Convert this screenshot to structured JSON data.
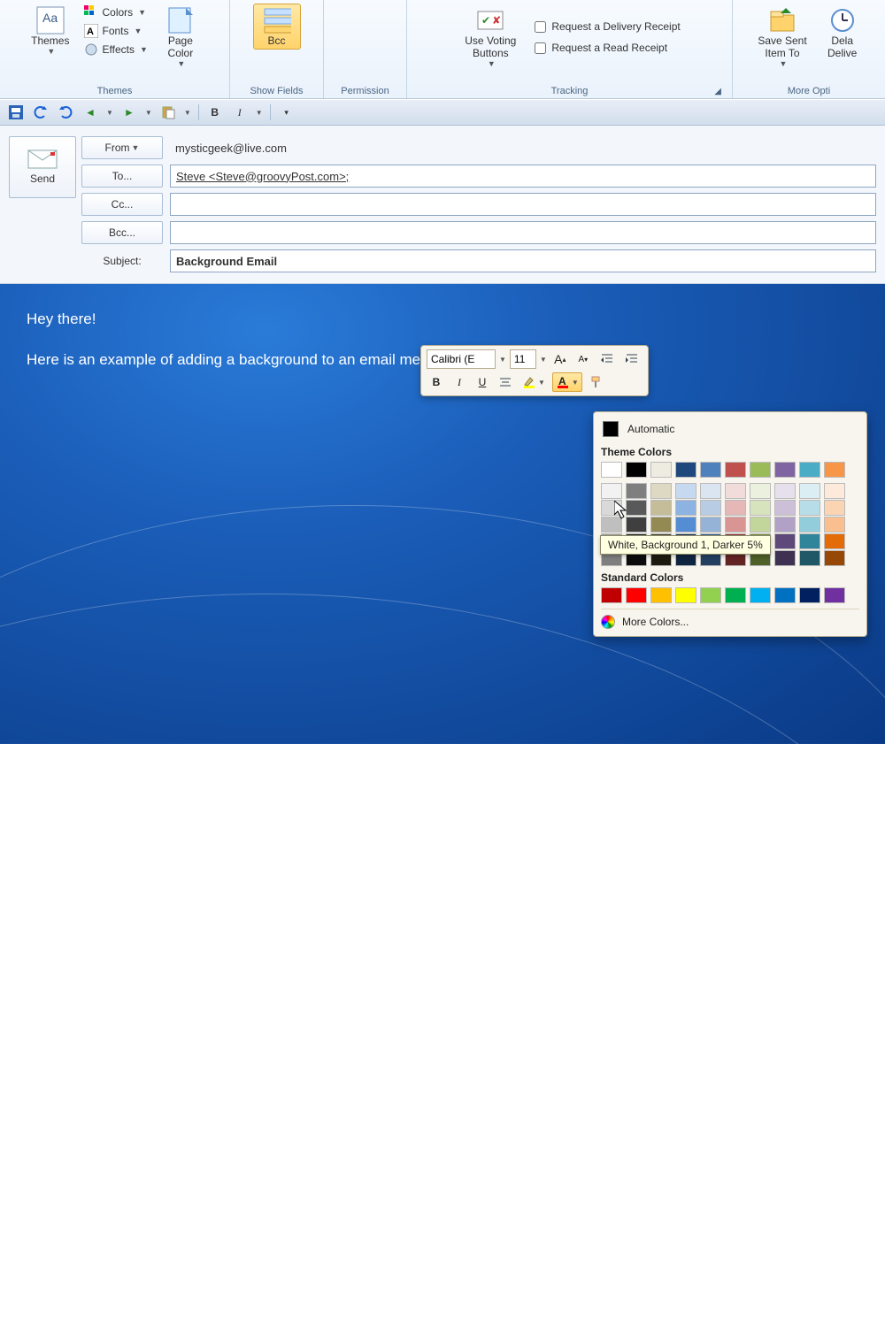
{
  "ribbon": {
    "themes": {
      "label": "Themes",
      "btn": "Themes",
      "colors": "Colors",
      "fonts": "Fonts",
      "effects": "Effects",
      "pagecolor": "Page\nColor"
    },
    "showfields": {
      "label": "Show Fields",
      "bcc": "Bcc"
    },
    "permission": {
      "label": "Permission"
    },
    "tracking": {
      "label": "Tracking",
      "voting": "Use Voting\nButtons",
      "delivery": "Request a Delivery Receipt",
      "read": "Request a Read Receipt"
    },
    "moreoptions": {
      "label": "More Opti",
      "savesent": "Save Sent\nItem To",
      "delay": "Dela\nDelive"
    }
  },
  "qat": {},
  "compose": {
    "send": "Send",
    "from_btn": "From",
    "from_val": "mysticgeek@live.com",
    "to_btn": "To...",
    "to_val": "Steve <Steve@groovyPost.com>;",
    "cc_btn": "Cc...",
    "cc_val": "",
    "bcc_btn": "Bcc...",
    "bcc_val": "",
    "subject_lbl": "Subject:",
    "subject_val": "Background Email"
  },
  "body": {
    "line1": "Hey there!",
    "line2": "Here is an example of adding a background to an email message."
  },
  "mini": {
    "font": "Calibri (E",
    "size": "11"
  },
  "picker": {
    "automatic": "Automatic",
    "theme_header": "Theme Colors",
    "standard_header": "Standard Colors",
    "more": "More Colors...",
    "tooltip": "White, Background 1, Darker 5%",
    "theme_row_main": [
      "#ffffff",
      "#000000",
      "#eeece1",
      "#1f497d",
      "#4f81bd",
      "#c0504d",
      "#9bbb59",
      "#8064a2",
      "#4bacc6",
      "#f79646"
    ],
    "theme_shades": [
      [
        "#f2f2f2",
        "#7f7f7f",
        "#ddd9c3",
        "#c6d9f0",
        "#dbe5f1",
        "#f2dcdb",
        "#ebf1de",
        "#e5e0ec",
        "#dbeef4",
        "#fdeada"
      ],
      [
        "#d9d9d9",
        "#595959",
        "#c4bd97",
        "#8db3e2",
        "#b8cce4",
        "#e5b8b7",
        "#d6e3bc",
        "#ccc0d9",
        "#b6dde8",
        "#fbd4b4"
      ],
      [
        "#bfbfbf",
        "#3f3f3f",
        "#938953",
        "#548dd4",
        "#95b3d7",
        "#d99594",
        "#c2d69b",
        "#b2a1c7",
        "#92cddc",
        "#fabf8f"
      ],
      [
        "#a5a5a5",
        "#262626",
        "#4a452a",
        "#17365d",
        "#366092",
        "#953734",
        "#76923c",
        "#5f497a",
        "#31859b",
        "#e36c09"
      ],
      [
        "#7f7f7f",
        "#0c0c0c",
        "#1d1b10",
        "#0f243e",
        "#244061",
        "#632423",
        "#4f6128",
        "#3f3151",
        "#205867",
        "#974806"
      ]
    ],
    "standard": [
      "#c00000",
      "#ff0000",
      "#ffc000",
      "#ffff00",
      "#92d050",
      "#00b050",
      "#00b0f0",
      "#0070c0",
      "#002060",
      "#7030a0"
    ]
  }
}
